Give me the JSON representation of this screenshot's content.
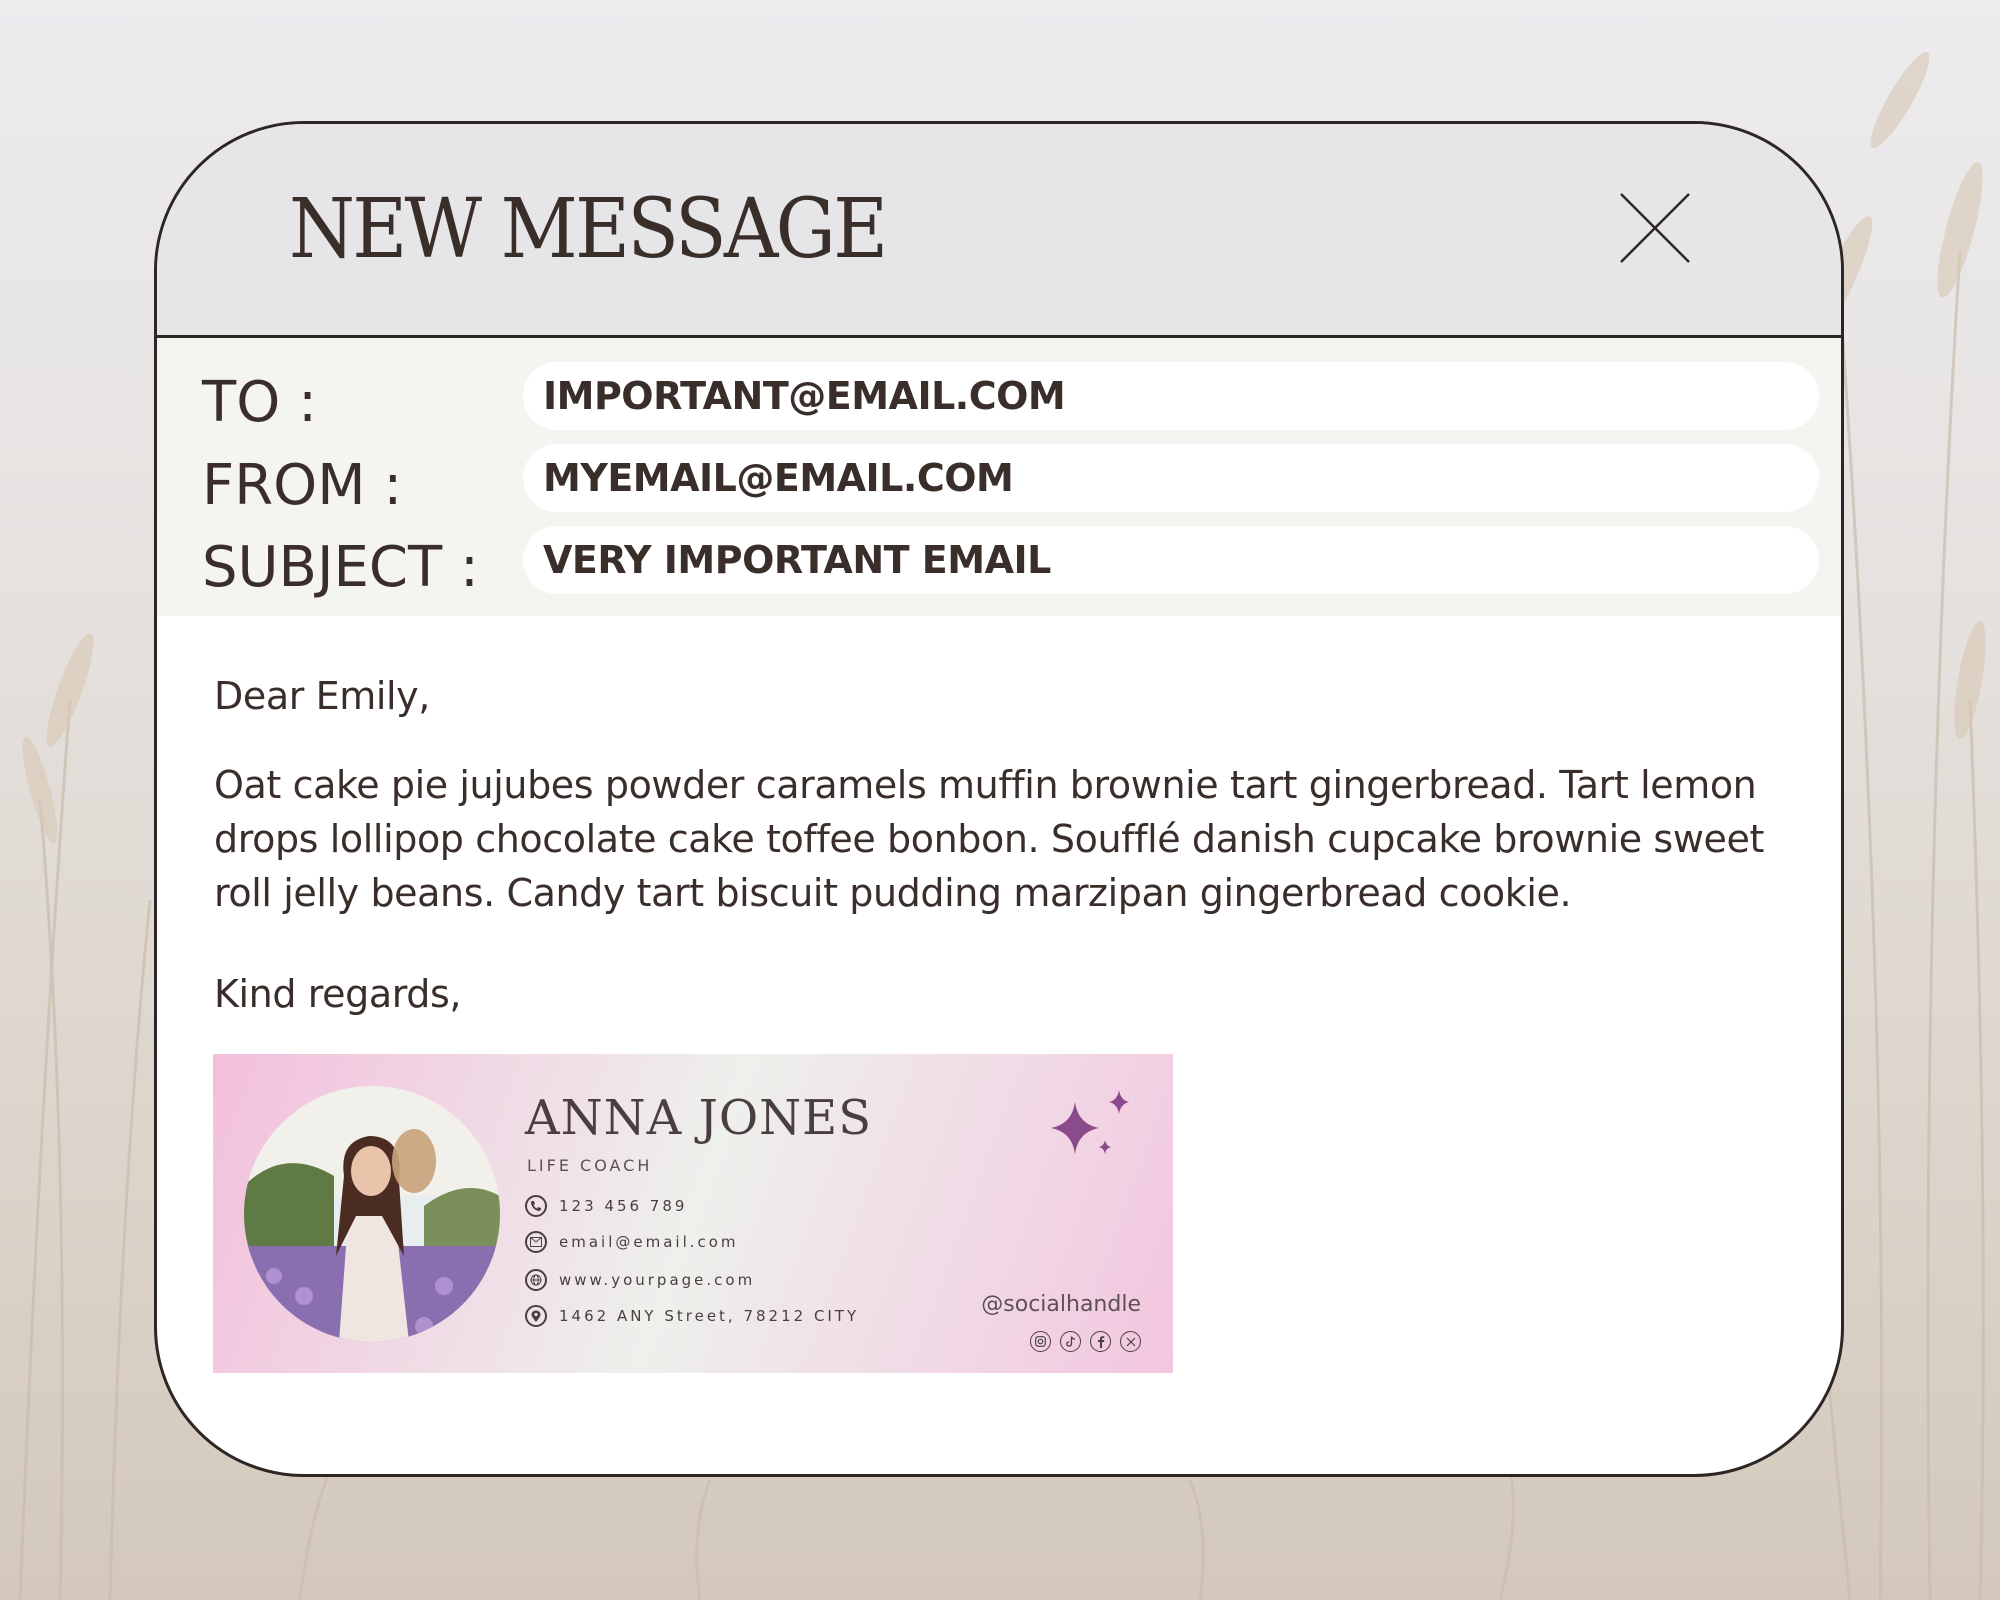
{
  "window": {
    "title": "NEW MESSAGE"
  },
  "fields": {
    "to_label": "TO :",
    "to_value": "IMPORTANT@EMAIL.COM",
    "from_label": "FROM :",
    "from_value": "MYEMAIL@EMAIL.COM",
    "subject_label": "SUBJECT :",
    "subject_value": "VERY IMPORTANT EMAIL"
  },
  "message": {
    "greeting": "Dear Emily,",
    "body": "Oat cake pie jujubes powder caramels muffin brownie tart gingerbread. Tart lemon drops lollipop chocolate cake toffee bonbon. Soufflé danish cupcake brownie sweet roll jelly beans. Candy tart biscuit pudding marzipan gingerbread cookie.",
    "closing": "Kind regards,"
  },
  "signature": {
    "name": "ANNA JONES",
    "role": "LIFE COACH",
    "phone": "123 456 789",
    "email": "email@email.com",
    "website": "www.yourpage.com",
    "address": "1462 ANY Street, 78212 CITY",
    "handle": "@socialhandle",
    "social_icons": [
      "instagram-icon",
      "tiktok-icon",
      "facebook-icon",
      "x-icon"
    ],
    "colors": {
      "accent": "#8a4a8c",
      "gradient_pink": "#f3bfdc"
    }
  },
  "colors": {
    "text": "#3a2e2b",
    "titlebar": "#e6e6e8",
    "fields_bg": "#f4f4f1",
    "border": "#2e2624"
  }
}
